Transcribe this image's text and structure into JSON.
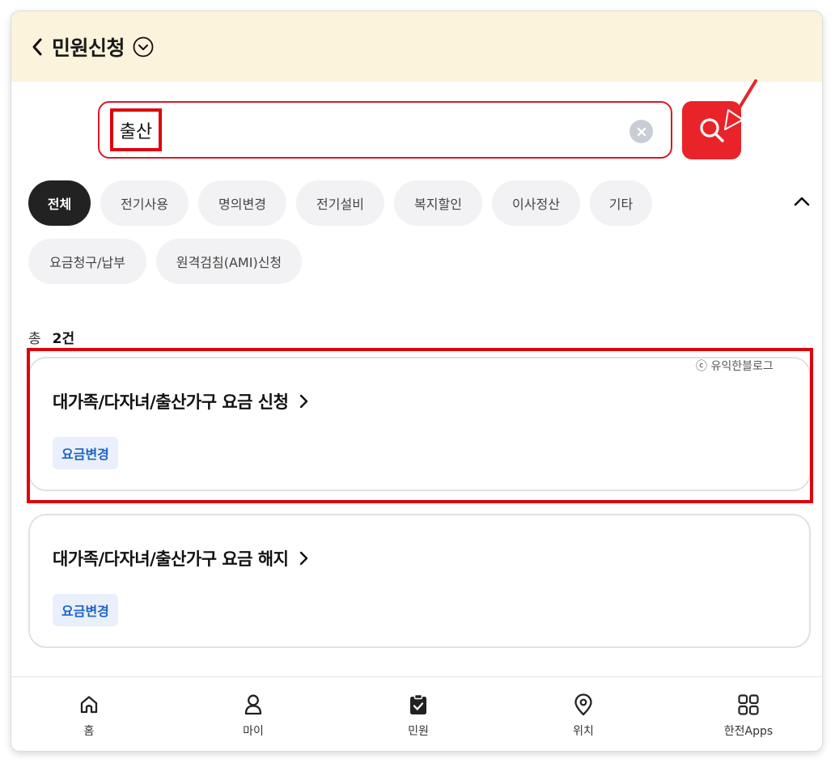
{
  "header": {
    "title": "민원신청"
  },
  "search": {
    "value": "출산"
  },
  "filters": {
    "row1": [
      "전체",
      "전기사용",
      "명의변경",
      "전기설비",
      "복지할인",
      "이사정산",
      "기타"
    ],
    "row2": [
      "요금청구/납부",
      "원격검침(AMI)신청"
    ],
    "active": "전체"
  },
  "results": {
    "total_prefix": "총",
    "total_count": "2건",
    "items": [
      {
        "title": "대가족/다자녀/출산가구 요금 신청",
        "tag": "요금변경"
      },
      {
        "title": "대가족/다자녀/출산가구 요금 해지",
        "tag": "요금변경"
      }
    ]
  },
  "watermark": "ⓒ 유익한블로그",
  "bottom_nav": [
    {
      "label": "홈",
      "icon": "home-icon"
    },
    {
      "label": "마이",
      "icon": "person-icon"
    },
    {
      "label": "민원",
      "icon": "clipboard-check-icon"
    },
    {
      "label": "위치",
      "icon": "location-pin-icon"
    },
    {
      "label": "한전Apps",
      "icon": "apps-grid-icon"
    }
  ],
  "colors": {
    "accent": "#e8242a",
    "header_bg": "#fbf3dc",
    "tag_text": "#1e63c6",
    "tag_bg": "#e9f0fb",
    "annotation": "#e0000c"
  }
}
